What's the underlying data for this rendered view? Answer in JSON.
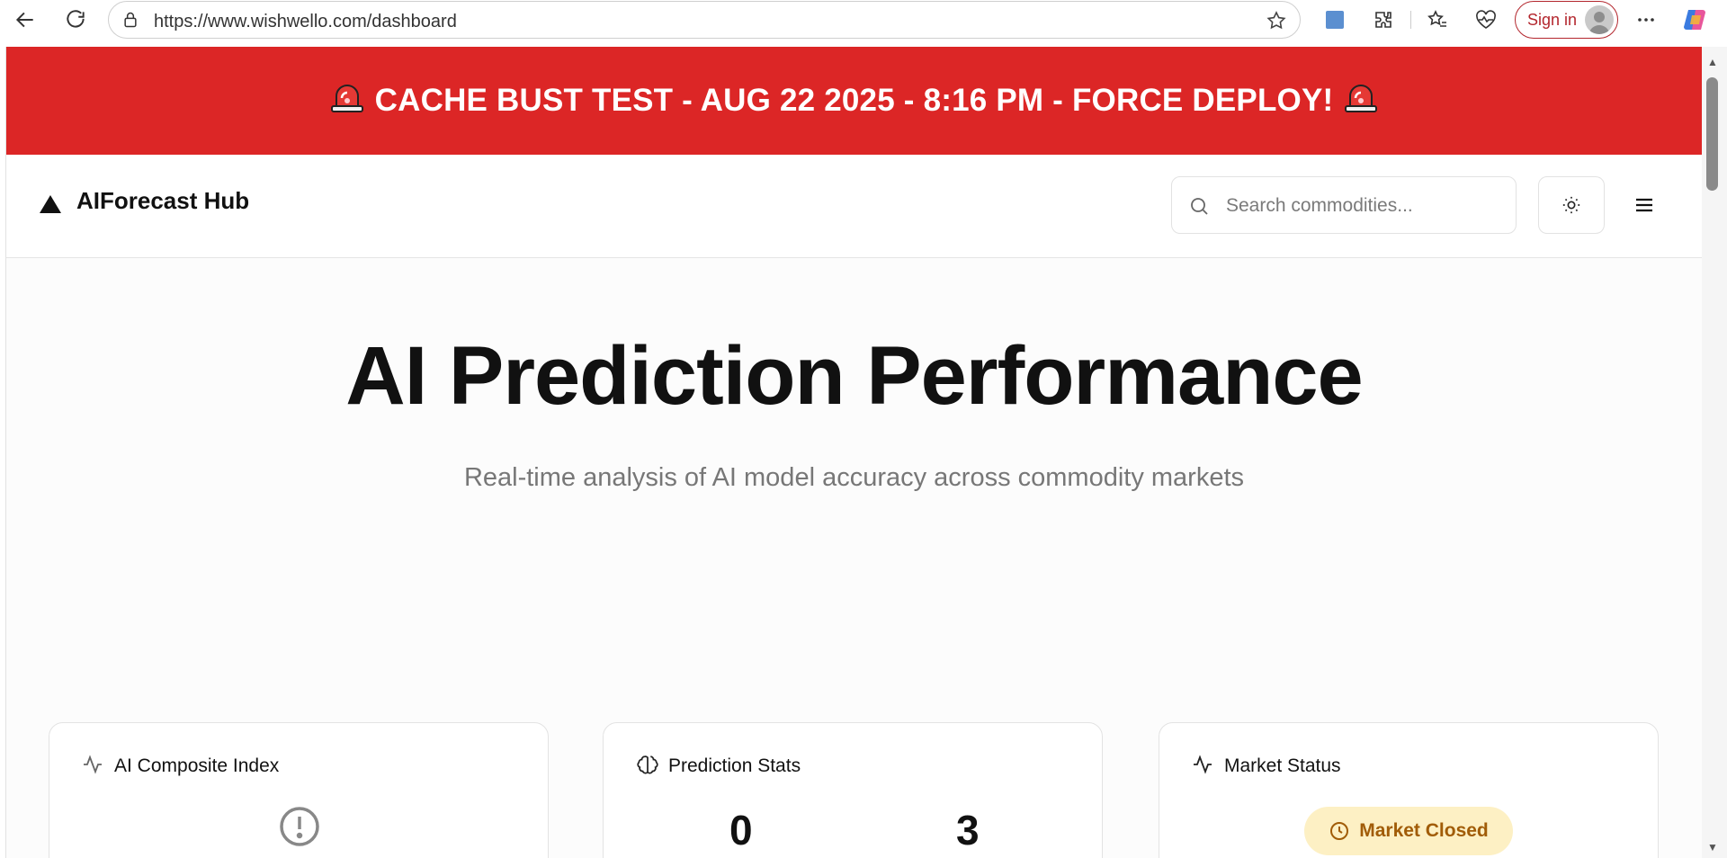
{
  "browser": {
    "url": "https://www.wishwello.com/dashboard",
    "sign_in_label": "Sign in"
  },
  "banner": {
    "text": "CACHE BUST TEST - AUG 22 2025 - 8:16 PM - FORCE DEPLOY!",
    "color": "#dc2626",
    "icon": "siren-icon"
  },
  "header": {
    "logo_text": "AIForecast Hub",
    "search_placeholder": "Search commodities...",
    "theme_icon": "sun-icon",
    "menu_icon": "hamburger-icon"
  },
  "hero": {
    "title": "AI Prediction Performance",
    "subtitle": "Real-time analysis of AI model accuracy across commodity markets"
  },
  "cards": {
    "composite": {
      "title": "AI Composite Index",
      "icon": "activity-icon",
      "status_icon": "alert-circle-icon"
    },
    "stats": {
      "title": "Prediction Stats",
      "icon": "brain-icon",
      "value_1": "0",
      "value_2": "3"
    },
    "market": {
      "title": "Market Status",
      "icon": "activity-icon",
      "status_label": "Market Closed",
      "status_color": "#fdf0c4"
    }
  }
}
